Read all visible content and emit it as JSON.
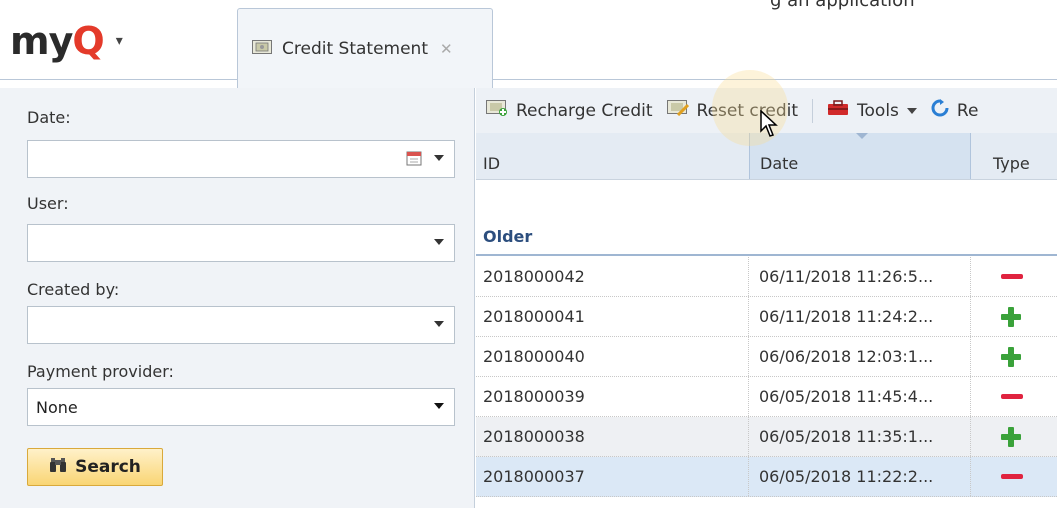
{
  "window_top_cutoff_text": "g an application",
  "app": {
    "logo_text_my": "my",
    "logo_text_q": "Q"
  },
  "tab": {
    "label": "Credit Statement",
    "close_glyph": "✕",
    "icon": "credit-card-icon"
  },
  "filters": {
    "date": {
      "label": "Date:",
      "value": ""
    },
    "user": {
      "label": "User:",
      "value": ""
    },
    "created_by": {
      "label": "Created by:",
      "value": ""
    },
    "payment_provider": {
      "label": "Payment provider:",
      "value": "None"
    },
    "search_label": "Search"
  },
  "toolbar": {
    "recharge_label": "Recharge Credit",
    "reset_label": "Reset credit",
    "tools_label": "Tools",
    "refresh_label": "Re"
  },
  "columns": {
    "id": "ID",
    "date": "Date",
    "type": "Type"
  },
  "group": {
    "label": "Older"
  },
  "rows": [
    {
      "id": "2018000042",
      "date": "06/11/2018 11:26:5...",
      "type": "minus"
    },
    {
      "id": "2018000041",
      "date": "06/11/2018 11:24:2...",
      "type": "plus"
    },
    {
      "id": "2018000040",
      "date": "06/06/2018 12:03:1...",
      "type": "plus"
    },
    {
      "id": "2018000039",
      "date": "06/05/2018 11:45:4...",
      "type": "minus"
    },
    {
      "id": "2018000038",
      "date": "06/05/2018 11:35:1...",
      "type": "plus"
    },
    {
      "id": "2018000037",
      "date": "06/05/2018 11:22:2...",
      "type": "minus"
    }
  ],
  "colors": {
    "accent": "#2c4e7e",
    "brand_q": "#e43a2a",
    "minus": "#e0233f",
    "plus": "#3aa23a"
  }
}
